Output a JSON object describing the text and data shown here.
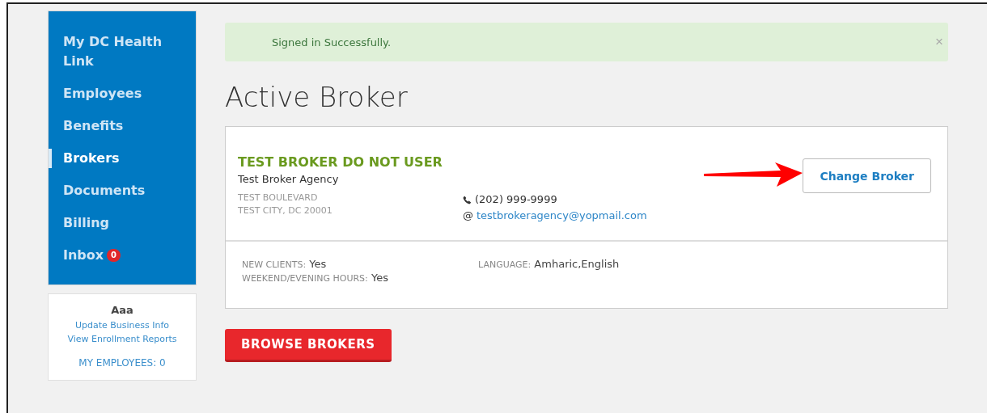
{
  "sidebar": {
    "items": [
      {
        "label": "My DC Health Link",
        "selected": false
      },
      {
        "label": "Employees",
        "selected": false
      },
      {
        "label": "Benefits",
        "selected": false
      },
      {
        "label": "Brokers",
        "selected": true
      },
      {
        "label": "Documents",
        "selected": false
      },
      {
        "label": "Billing",
        "selected": false
      },
      {
        "label": "Inbox",
        "selected": false,
        "badge": "0"
      }
    ]
  },
  "employer_card": {
    "name": "Aaa",
    "links": [
      "Update Business Info",
      "View Enrollment Reports"
    ],
    "employees": "MY EMPLOYEES: 0"
  },
  "alert": {
    "message": "Signed in Successfully.",
    "close": "×"
  },
  "heading": "Active Broker",
  "broker": {
    "name": "TEST BROKER DO NOT USER",
    "agency": "Test Broker Agency",
    "address": [
      "TEST BOULEVARD",
      "TEST CITY, DC 20001"
    ],
    "phone": "(202) 999-9999",
    "email_prefix": "@",
    "email": "testbrokeragency@yopmail.com",
    "change_button": "Change Broker",
    "details": [
      {
        "label": "NEW CLIENTS:",
        "value": "Yes"
      },
      {
        "label": "WEEKEND/EVENING HOURS:",
        "value": "Yes"
      },
      {
        "label": "LANGUAGE:",
        "value": "Amharic,English"
      }
    ]
  },
  "browse_button": "BROWSE BROKERS"
}
